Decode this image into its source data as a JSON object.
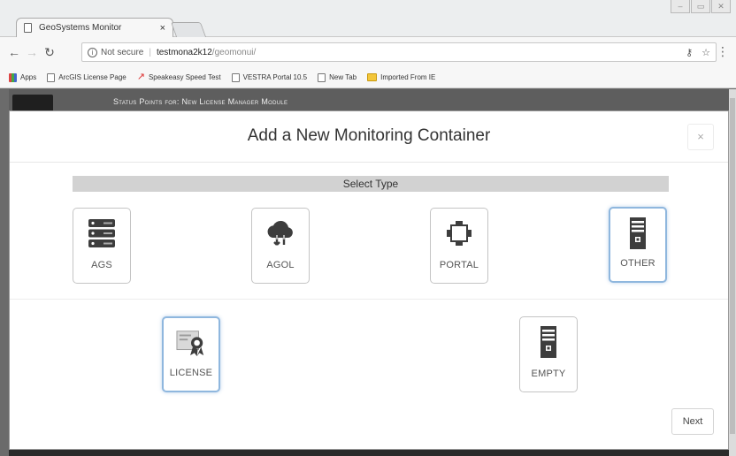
{
  "browser": {
    "tab_title": "GeoSystems Monitor",
    "tab_close": "×",
    "address": {
      "not_secure": "Not secure",
      "separator": "|",
      "host": "testmona2k12",
      "path": "/geomonui/"
    },
    "bookmarks": [
      {
        "label": "Apps",
        "icon": "apps-icon"
      },
      {
        "label": "ArcGIS License Page",
        "icon": "page-icon"
      },
      {
        "label": "Speakeasy Speed Test",
        "icon": "speakeasy-icon"
      },
      {
        "label": "VESTRA Portal 10.5",
        "icon": "page-icon"
      },
      {
        "label": "New Tab",
        "icon": "page-icon"
      },
      {
        "label": "Imported From IE",
        "icon": "folder-icon"
      }
    ]
  },
  "page": {
    "heading": "Status Points for: New License Manager Module"
  },
  "modal": {
    "title": "Add a New Monitoring Container",
    "close_label": "×",
    "section_label": "Select Type",
    "types": [
      {
        "label": "AGS",
        "icon": "server-rack-icon",
        "selected": false
      },
      {
        "label": "AGOL",
        "icon": "cloud-sync-icon",
        "selected": false
      },
      {
        "label": "PORTAL",
        "icon": "portal-nodes-icon",
        "selected": false
      },
      {
        "label": "OTHER",
        "icon": "server-tower-icon",
        "selected": true
      },
      {
        "label": "LICENSE",
        "icon": "license-certificate-icon",
        "selected": true
      },
      {
        "label": "EMPTY",
        "icon": "server-tower-icon",
        "selected": false
      }
    ],
    "next_label": "Next"
  },
  "colors": {
    "selected_border": "#8fb7de",
    "section_bar": "#d2d2d2",
    "backdrop": "#5e5e5e"
  }
}
